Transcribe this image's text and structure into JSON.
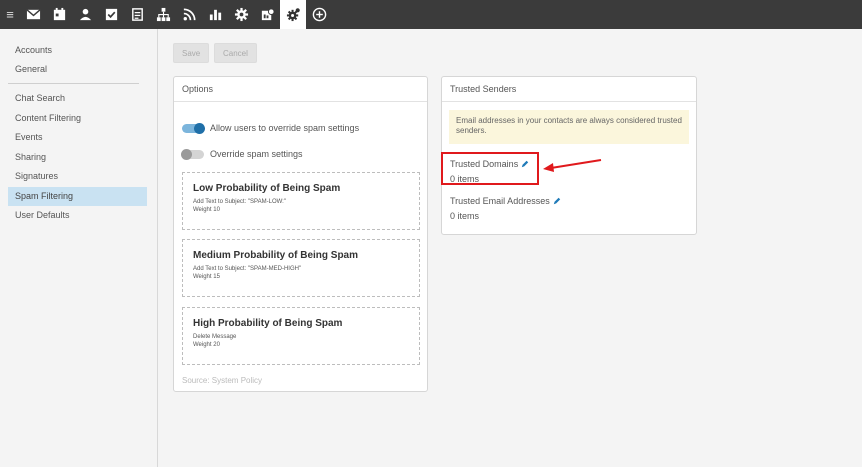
{
  "toolbar": {
    "menu_icon": "hamburger-icon",
    "tools": [
      {
        "icon": "mail-icon"
      },
      {
        "icon": "calendar-icon"
      },
      {
        "icon": "contacts-icon"
      },
      {
        "icon": "tasks-icon"
      },
      {
        "icon": "notes-icon"
      },
      {
        "icon": "sitemap-icon"
      },
      {
        "icon": "rss-icon"
      },
      {
        "icon": "reports-icon"
      },
      {
        "icon": "settings-gear-icon"
      },
      {
        "icon": "domain-settings-icon"
      },
      {
        "icon": "system-settings-icon",
        "active": true
      },
      {
        "icon": "add-circle-icon"
      }
    ],
    "accent_color": "#3b3b3b"
  },
  "sidebar": {
    "items": [
      {
        "label": "Accounts"
      },
      {
        "label": "General"
      },
      {
        "label": "Chat Search"
      },
      {
        "label": "Content Filtering"
      },
      {
        "label": "Events"
      },
      {
        "label": "Sharing"
      },
      {
        "label": "Signatures"
      },
      {
        "label": "Spam Filtering",
        "active": true
      },
      {
        "label": "User Defaults"
      }
    ]
  },
  "actions": {
    "save_label": "Save",
    "cancel_label": "Cancel"
  },
  "options": {
    "title": "Options",
    "toggle_allow_label": "Allow users to override spam settings",
    "toggle_allow_on": true,
    "toggle_override_label": "Override spam settings",
    "toggle_override_on": false,
    "levels": [
      {
        "title": "Low Probability of Being Spam",
        "action": "Add Text to Subject: \"SPAM-LOW:\"",
        "weight": "Weight 10"
      },
      {
        "title": "Medium Probability of Being Spam",
        "action": "Add Text to Subject: \"SPAM-MED-HIGH\"",
        "weight": "Weight 15"
      },
      {
        "title": "High Probability of Being Spam",
        "action": "Delete Message",
        "weight": "Weight 20"
      }
    ],
    "source": "Source: System Policy"
  },
  "trusted": {
    "title": "Trusted Senders",
    "info": "Email addresses in your contacts are always considered trusted senders.",
    "domains_label": "Trusted Domains",
    "domains_count": "0 items",
    "emails_label": "Trusted Email Addresses",
    "emails_count": "0 items"
  },
  "annotation": {
    "color": "#e0191c"
  }
}
